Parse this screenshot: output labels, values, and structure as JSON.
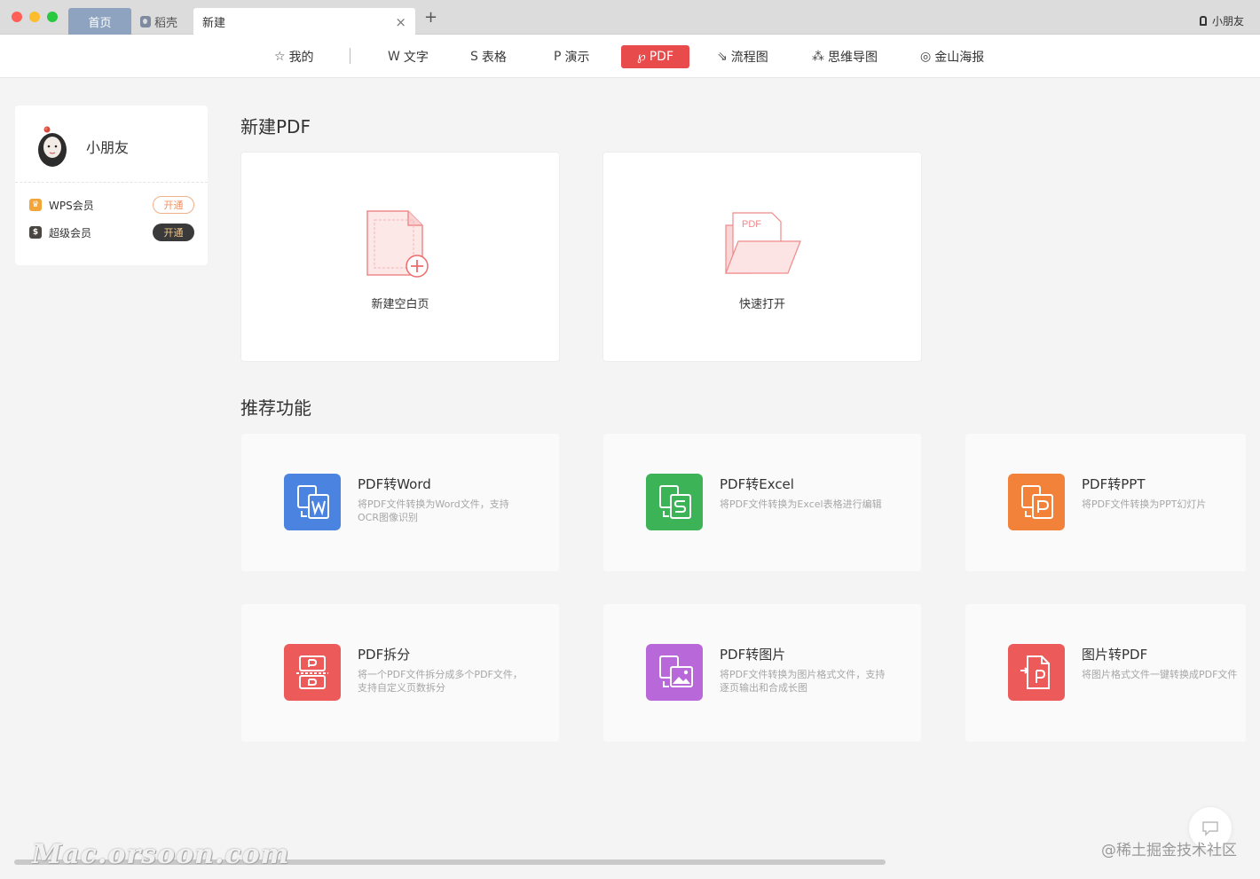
{
  "tabs": {
    "home": "首页",
    "daoke": "稻壳",
    "new": "新建",
    "close": "×",
    "add": "+"
  },
  "user_top": "小朋友",
  "toolbar": [
    {
      "icon": "star-icon",
      "glyph": "☆",
      "label": "我的"
    },
    {
      "icon": "w-icon",
      "glyph": "W",
      "label": "文字"
    },
    {
      "icon": "s-icon",
      "glyph": "S",
      "label": "表格"
    },
    {
      "icon": "p-icon",
      "glyph": "P",
      "label": "演示"
    },
    {
      "icon": "pdf-icon",
      "glyph": "℘",
      "label": "PDF"
    },
    {
      "icon": "flowchart-icon",
      "glyph": "⇘",
      "label": "流程图"
    },
    {
      "icon": "mindmap-icon",
      "glyph": "⁂",
      "label": "思维导图"
    },
    {
      "icon": "poster-icon",
      "glyph": "◎",
      "label": "金山海报"
    }
  ],
  "usercard": {
    "name": "小朋友",
    "members": [
      {
        "label": "WPS会员",
        "button": "开通"
      },
      {
        "label": "超级会员",
        "button": "开通"
      }
    ]
  },
  "new_section": {
    "title": "新建PDF",
    "cards": [
      {
        "label": "新建空白页"
      },
      {
        "label": "快速打开",
        "icon_text": "PDF"
      }
    ]
  },
  "recommend": {
    "title": "推荐功能",
    "items": [
      {
        "title": "PDF转Word",
        "desc": "将PDF文件转换为Word文件，支持OCR图像识别",
        "color": "#4a84e0",
        "icon": "pdf-to-word-icon"
      },
      {
        "title": "PDF转Excel",
        "desc": "将PDF文件转换为Excel表格进行编辑",
        "color": "#3db358",
        "icon": "pdf-to-excel-icon"
      },
      {
        "title": "PDF转PPT",
        "desc": "将PDF文件转换为PPT幻灯片",
        "color": "#f2813a",
        "icon": "pdf-to-ppt-icon"
      },
      {
        "title": "PDF拆分",
        "desc": "将一个PDF文件拆分成多个PDF文件，支持自定义页数拆分",
        "color": "#ed5a5a",
        "icon": "pdf-split-icon"
      },
      {
        "title": "PDF转图片",
        "desc": "将PDF文件转换为图片格式文件，支持逐页输出和合成长图",
        "color": "#b968d9",
        "icon": "pdf-to-image-icon"
      },
      {
        "title": "图片转PDF",
        "desc": "将图片格式文件一键转换成PDF文件",
        "color": "#ed5a5a",
        "icon": "image-to-pdf-icon"
      }
    ]
  },
  "watermarks": {
    "left": "Mac.orsoon.com",
    "right": "@稀土掘金技术社区"
  }
}
